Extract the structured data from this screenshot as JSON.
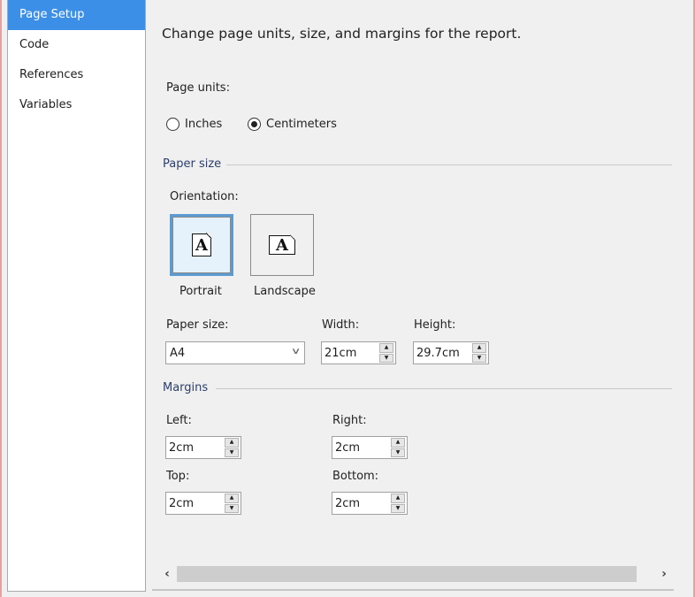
{
  "sidebar": {
    "items": [
      {
        "label": "Page Setup",
        "active": true
      },
      {
        "label": "Code",
        "active": false
      },
      {
        "label": "References",
        "active": false
      },
      {
        "label": "Variables",
        "active": false
      }
    ]
  },
  "main": {
    "description": "Change page units, size, and margins for the report.",
    "page_units": {
      "label": "Page units:",
      "options": [
        {
          "label": "Inches",
          "checked": false
        },
        {
          "label": "Centimeters",
          "checked": true
        }
      ]
    },
    "paper_size_group": {
      "title": "Paper size",
      "orientation_label": "Orientation:",
      "orientations": [
        {
          "label": "Portrait",
          "icon": "portrait-page-icon",
          "glyph": "A",
          "selected": true
        },
        {
          "label": "Landscape",
          "icon": "landscape-page-icon",
          "glyph": "A",
          "selected": false
        }
      ],
      "paper_size_label": "Paper size:",
      "paper_size_value": "A4",
      "width_label": "Width:",
      "width_value": "21cm",
      "height_label": "Height:",
      "height_value": "29.7cm"
    },
    "margins_group": {
      "title": "Margins",
      "left_label": "Left:",
      "left_value": "2cm",
      "right_label": "Right:",
      "right_value": "2cm",
      "top_label": "Top:",
      "top_value": "2cm",
      "bottom_label": "Bottom:",
      "bottom_value": "2cm"
    }
  },
  "scrollbar": {
    "left_arrow": "‹",
    "right_arrow": "›"
  },
  "icons": {
    "chevron_down": "∨",
    "spin_up": "▲",
    "spin_down": "▼"
  },
  "colors": {
    "accent": "#3c8fe6",
    "selected_border": "#5c9bd1",
    "group_title": "#2c3e6b"
  }
}
